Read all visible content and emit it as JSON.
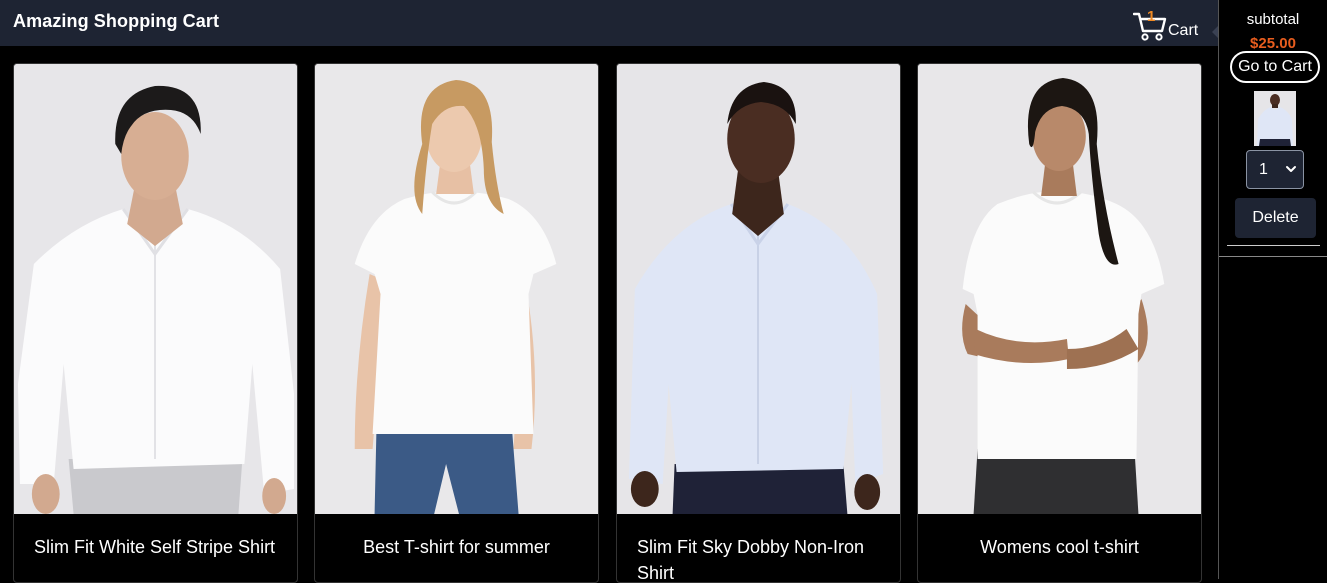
{
  "header": {
    "title": "Amazing Shopping Cart",
    "cart_count": "1",
    "cart_label": "Cart"
  },
  "products": [
    {
      "name": "Slim Fit White Self Stripe Shirt",
      "image": "man-white-shirt"
    },
    {
      "name": "Best T-shirt for summer",
      "image": "woman-white-tshirt"
    },
    {
      "name": "Slim Fit Sky Dobby Non-Iron Shirt",
      "image": "man-sky-shirt"
    },
    {
      "name": "Womens cool t-shirt",
      "image": "woman-white-tshirt"
    }
  ],
  "sidebar": {
    "subtotal_label": "subtotal",
    "subtotal_value": "$25.00",
    "go_to_cart_label": "Go to Cart",
    "quantity_selected": "1",
    "delete_label": "Delete"
  },
  "colors": {
    "header_bg": "#1e2433",
    "accent_orange": "#e85d1e",
    "badge_orange": "#f08a24",
    "page_bg": "#000000"
  }
}
